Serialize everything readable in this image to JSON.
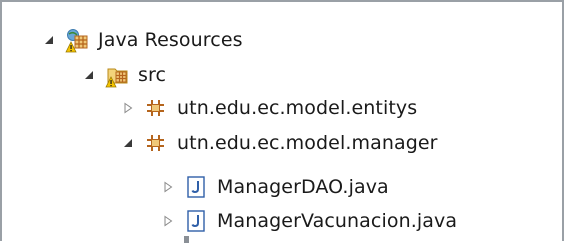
{
  "tree": {
    "java_resources": {
      "label": "Java Resources",
      "expanded": true,
      "icon": "java-resources-warning-icon"
    },
    "src": {
      "label": "src",
      "expanded": true,
      "icon": "source-folder-warning-icon"
    },
    "packages": [
      {
        "label": "utn.edu.ec.model.entitys",
        "expanded": false,
        "icon": "package-icon"
      },
      {
        "label": "utn.edu.ec.model.manager",
        "expanded": true,
        "icon": "package-icon"
      }
    ],
    "files": [
      {
        "label": "ManagerDAO.java",
        "expanded": false,
        "icon": "java-file-icon"
      },
      {
        "label": "ManagerVacunacion.java",
        "expanded": false,
        "icon": "java-file-icon"
      }
    ]
  },
  "colors": {
    "package": "#b5651d",
    "java_file": "#2f5fa8",
    "warning": "#f5c400",
    "twisty": "#333333"
  }
}
